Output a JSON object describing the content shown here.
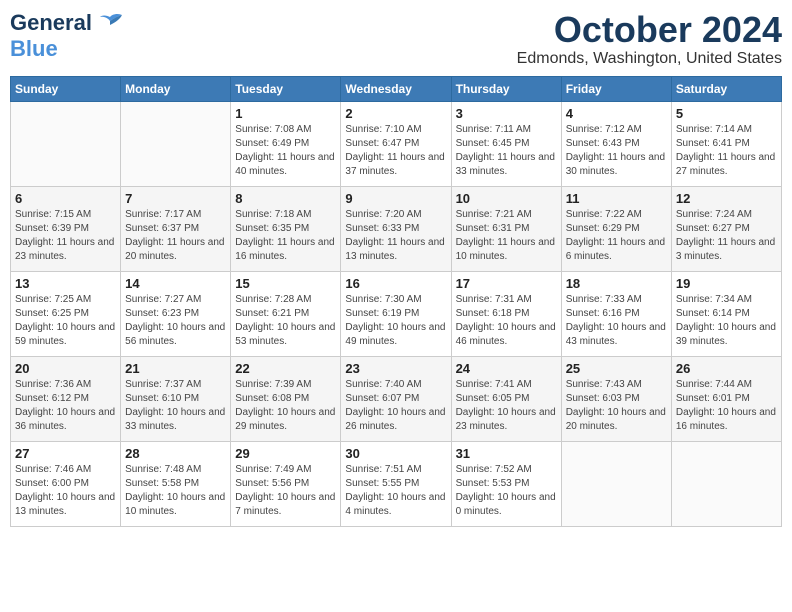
{
  "header": {
    "logo_line1": "General",
    "logo_line2": "Blue",
    "month": "October 2024",
    "location": "Edmonds, Washington, United States"
  },
  "columns": [
    "Sunday",
    "Monday",
    "Tuesday",
    "Wednesday",
    "Thursday",
    "Friday",
    "Saturday"
  ],
  "weeks": [
    [
      {
        "day": "",
        "content": ""
      },
      {
        "day": "",
        "content": ""
      },
      {
        "day": "1",
        "content": "Sunrise: 7:08 AM\nSunset: 6:49 PM\nDaylight: 11 hours and 40 minutes."
      },
      {
        "day": "2",
        "content": "Sunrise: 7:10 AM\nSunset: 6:47 PM\nDaylight: 11 hours and 37 minutes."
      },
      {
        "day": "3",
        "content": "Sunrise: 7:11 AM\nSunset: 6:45 PM\nDaylight: 11 hours and 33 minutes."
      },
      {
        "day": "4",
        "content": "Sunrise: 7:12 AM\nSunset: 6:43 PM\nDaylight: 11 hours and 30 minutes."
      },
      {
        "day": "5",
        "content": "Sunrise: 7:14 AM\nSunset: 6:41 PM\nDaylight: 11 hours and 27 minutes."
      }
    ],
    [
      {
        "day": "6",
        "content": "Sunrise: 7:15 AM\nSunset: 6:39 PM\nDaylight: 11 hours and 23 minutes."
      },
      {
        "day": "7",
        "content": "Sunrise: 7:17 AM\nSunset: 6:37 PM\nDaylight: 11 hours and 20 minutes."
      },
      {
        "day": "8",
        "content": "Sunrise: 7:18 AM\nSunset: 6:35 PM\nDaylight: 11 hours and 16 minutes."
      },
      {
        "day": "9",
        "content": "Sunrise: 7:20 AM\nSunset: 6:33 PM\nDaylight: 11 hours and 13 minutes."
      },
      {
        "day": "10",
        "content": "Sunrise: 7:21 AM\nSunset: 6:31 PM\nDaylight: 11 hours and 10 minutes."
      },
      {
        "day": "11",
        "content": "Sunrise: 7:22 AM\nSunset: 6:29 PM\nDaylight: 11 hours and 6 minutes."
      },
      {
        "day": "12",
        "content": "Sunrise: 7:24 AM\nSunset: 6:27 PM\nDaylight: 11 hours and 3 minutes."
      }
    ],
    [
      {
        "day": "13",
        "content": "Sunrise: 7:25 AM\nSunset: 6:25 PM\nDaylight: 10 hours and 59 minutes."
      },
      {
        "day": "14",
        "content": "Sunrise: 7:27 AM\nSunset: 6:23 PM\nDaylight: 10 hours and 56 minutes."
      },
      {
        "day": "15",
        "content": "Sunrise: 7:28 AM\nSunset: 6:21 PM\nDaylight: 10 hours and 53 minutes."
      },
      {
        "day": "16",
        "content": "Sunrise: 7:30 AM\nSunset: 6:19 PM\nDaylight: 10 hours and 49 minutes."
      },
      {
        "day": "17",
        "content": "Sunrise: 7:31 AM\nSunset: 6:18 PM\nDaylight: 10 hours and 46 minutes."
      },
      {
        "day": "18",
        "content": "Sunrise: 7:33 AM\nSunset: 6:16 PM\nDaylight: 10 hours and 43 minutes."
      },
      {
        "day": "19",
        "content": "Sunrise: 7:34 AM\nSunset: 6:14 PM\nDaylight: 10 hours and 39 minutes."
      }
    ],
    [
      {
        "day": "20",
        "content": "Sunrise: 7:36 AM\nSunset: 6:12 PM\nDaylight: 10 hours and 36 minutes."
      },
      {
        "day": "21",
        "content": "Sunrise: 7:37 AM\nSunset: 6:10 PM\nDaylight: 10 hours and 33 minutes."
      },
      {
        "day": "22",
        "content": "Sunrise: 7:39 AM\nSunset: 6:08 PM\nDaylight: 10 hours and 29 minutes."
      },
      {
        "day": "23",
        "content": "Sunrise: 7:40 AM\nSunset: 6:07 PM\nDaylight: 10 hours and 26 minutes."
      },
      {
        "day": "24",
        "content": "Sunrise: 7:41 AM\nSunset: 6:05 PM\nDaylight: 10 hours and 23 minutes."
      },
      {
        "day": "25",
        "content": "Sunrise: 7:43 AM\nSunset: 6:03 PM\nDaylight: 10 hours and 20 minutes."
      },
      {
        "day": "26",
        "content": "Sunrise: 7:44 AM\nSunset: 6:01 PM\nDaylight: 10 hours and 16 minutes."
      }
    ],
    [
      {
        "day": "27",
        "content": "Sunrise: 7:46 AM\nSunset: 6:00 PM\nDaylight: 10 hours and 13 minutes."
      },
      {
        "day": "28",
        "content": "Sunrise: 7:48 AM\nSunset: 5:58 PM\nDaylight: 10 hours and 10 minutes."
      },
      {
        "day": "29",
        "content": "Sunrise: 7:49 AM\nSunset: 5:56 PM\nDaylight: 10 hours and 7 minutes."
      },
      {
        "day": "30",
        "content": "Sunrise: 7:51 AM\nSunset: 5:55 PM\nDaylight: 10 hours and 4 minutes."
      },
      {
        "day": "31",
        "content": "Sunrise: 7:52 AM\nSunset: 5:53 PM\nDaylight: 10 hours and 0 minutes."
      },
      {
        "day": "",
        "content": ""
      },
      {
        "day": "",
        "content": ""
      }
    ]
  ]
}
